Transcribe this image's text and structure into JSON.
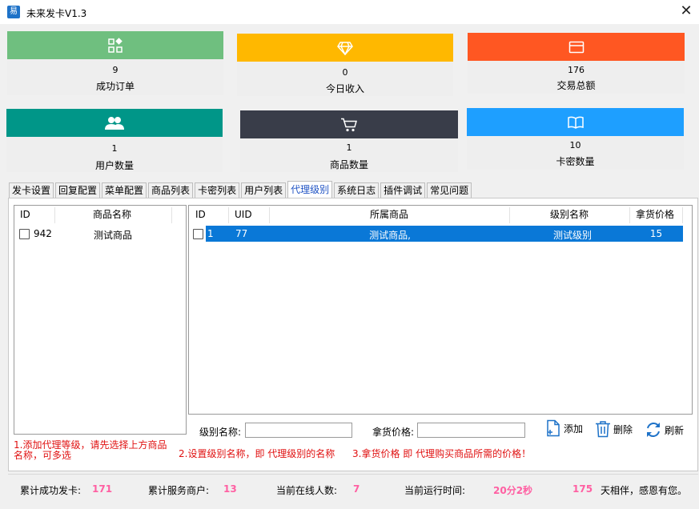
{
  "window": {
    "title": "未来发卡V1.3",
    "close_glyph": "✕",
    "app_icon_char": "易"
  },
  "stats": [
    {
      "value": "9",
      "label": "成功订单",
      "color": "#6fbf7f",
      "icon": "grid-icon"
    },
    {
      "value": "0",
      "label": "今日收入",
      "color": "#ffb800",
      "icon": "diamond-icon"
    },
    {
      "value": "176",
      "label": "交易总额",
      "color": "#ff5722",
      "icon": "card-icon"
    },
    {
      "value": "1",
      "label": "用户数量",
      "color": "#009688",
      "icon": "users-icon"
    },
    {
      "value": "1",
      "label": "商品数量",
      "color": "#393d49",
      "icon": "cart-icon"
    },
    {
      "value": "10",
      "label": "卡密数量",
      "color": "#1e9fff",
      "icon": "book-icon"
    }
  ],
  "tabs": [
    "发卡设置",
    "回复配置",
    "菜单配置",
    "商品列表",
    "卡密列表",
    "用户列表",
    "代理级别",
    "系统日志",
    "插件调试",
    "常见问题"
  ],
  "active_tab": "代理级别",
  "product_list": {
    "columns": [
      "ID",
      "商品名称"
    ],
    "rows": [
      {
        "id": "942",
        "name": "测试商品"
      }
    ]
  },
  "level_list": {
    "columns": [
      "ID",
      "UID",
      "所属商品",
      "级别名称",
      "拿货价格"
    ],
    "rows": [
      {
        "id": "1",
        "uid": "77",
        "product": "测试商品,",
        "level": "测试级别",
        "price": "15"
      }
    ]
  },
  "form": {
    "level_name_label": "级别名称:",
    "level_name_value": "",
    "price_label": "拿货价格:",
    "price_value": "",
    "add_label": "添加",
    "delete_label": "删除",
    "refresh_label": "刷新"
  },
  "hints": {
    "hint1_line1": "1.添加代理等级，请先选择上方商品",
    "hint1_line2": "名称，可多选",
    "hint2": "2.设置级别名称，即 代理级别的名称",
    "hint3": "3.拿货价格 即 代理购买商品所需的价格！"
  },
  "status": {
    "total_cards_label": "累计成功发卡:",
    "total_cards": "171",
    "merchants_label": "累计服务商户:",
    "merchants": "13",
    "online_label": "当前在线人数:",
    "online": "7",
    "runtime_label": "当前运行时间:",
    "runtime": "20分2秒",
    "days": "175",
    "thanks": "天相伴，感恩有您。"
  },
  "colors": {
    "selected_row": "#0a78d7",
    "accent_text": "#ff5fa2"
  }
}
